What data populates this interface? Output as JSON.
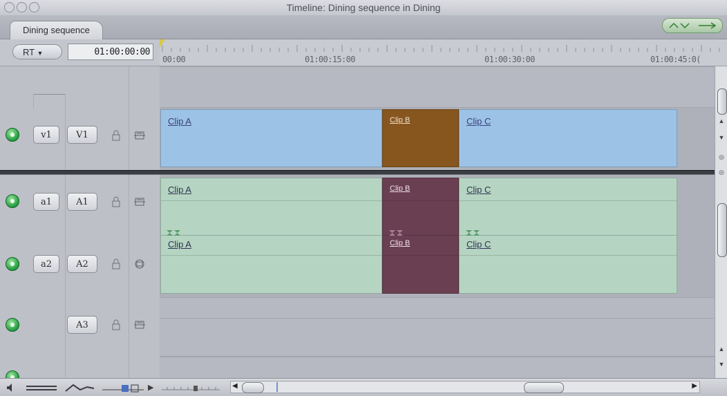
{
  "window": {
    "title": "Timeline: Dining sequence in Dining"
  },
  "tab": {
    "label": "Dining sequence"
  },
  "toolbar": {
    "rt_label": "RT",
    "timecode": "01:00:00:00"
  },
  "ruler": {
    "labels": [
      "00:00",
      "01:00:15:00",
      "01:00:30:00",
      "01:00:45:0("
    ]
  },
  "tracks": {
    "v1": {
      "source": "v1",
      "dest": "V1"
    },
    "a1": {
      "source": "a1",
      "dest": "A1"
    },
    "a2": {
      "source": "a2",
      "dest": "A2"
    },
    "a3": {
      "source": "",
      "dest": "A3"
    }
  },
  "clips": {
    "v1": [
      "Clip A",
      "Clip B",
      "Clip C"
    ],
    "a1": [
      "Clip A",
      "Clip B",
      "Clip C"
    ],
    "a2": [
      "Clip A",
      "Clip B",
      "Clip C"
    ]
  },
  "colors": {
    "video_clip": "#9cc3e6",
    "video_clip_selected": "#87561f",
    "audio_clip": "#b5d5c2",
    "audio_clip_selected": "#6a3f52",
    "track_enable": "#1f9b3c"
  },
  "icons": [
    "lock-icon",
    "patch-icon",
    "speaker-icon",
    "track-height-icon",
    "clip-overlay-icon",
    "zoom-slider-icon"
  ]
}
